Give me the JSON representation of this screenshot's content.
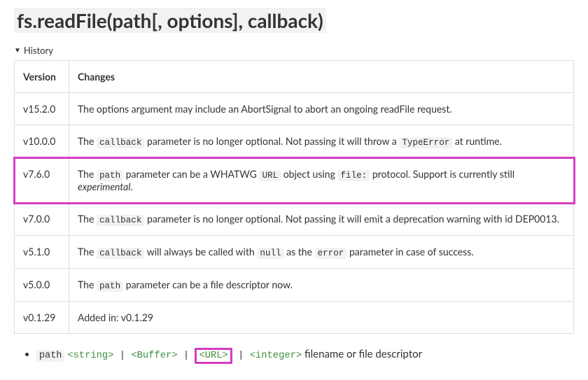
{
  "heading": "fs.readFile(path[, options], callback)",
  "history_label": "History",
  "table": {
    "headers": {
      "version": "Version",
      "changes": "Changes"
    },
    "rows": [
      {
        "version": "v15.2.0",
        "text_plain": "The options argument may include an AbortSignal to abort an ongoing readFile request."
      },
      {
        "version": "v10.0.0",
        "segments": [
          {
            "t": "The "
          },
          {
            "code": "callback"
          },
          {
            "t": " parameter is no longer optional. Not passing it will throw a "
          },
          {
            "code": "TypeError"
          },
          {
            "t": " at runtime."
          }
        ]
      },
      {
        "version": "v7.6.0",
        "highlighted": true,
        "segments": [
          {
            "t": "The "
          },
          {
            "code": "path"
          },
          {
            "t": " parameter can be a WHATWG "
          },
          {
            "code": "URL"
          },
          {
            "t": " object using "
          },
          {
            "code": "file:"
          },
          {
            "t": " protocol. Support is currently still "
          },
          {
            "italic": "experimental"
          },
          {
            "t": "."
          }
        ]
      },
      {
        "version": "v7.0.0",
        "segments": [
          {
            "t": "The "
          },
          {
            "code": "callback"
          },
          {
            "t": " parameter is no longer optional. Not passing it will emit a deprecation warning with id DEP0013."
          }
        ]
      },
      {
        "version": "v5.1.0",
        "segments": [
          {
            "t": "The "
          },
          {
            "code": "callback"
          },
          {
            "t": " will always be called with "
          },
          {
            "code": "null"
          },
          {
            "t": " as the "
          },
          {
            "code": "error"
          },
          {
            "t": " parameter in case of success."
          }
        ]
      },
      {
        "version": "v5.0.0",
        "segments": [
          {
            "t": "The "
          },
          {
            "code": "path"
          },
          {
            "t": " parameter can be a file descriptor now."
          }
        ]
      },
      {
        "version": "v0.1.29",
        "text_plain": "Added in: v0.1.29"
      }
    ]
  },
  "param": {
    "name": "path",
    "types": [
      {
        "label": "<string>"
      },
      {
        "label": "<Buffer>"
      },
      {
        "label": "<URL>",
        "boxed": true
      },
      {
        "label": "<integer>"
      }
    ],
    "desc": "filename or file descriptor"
  }
}
